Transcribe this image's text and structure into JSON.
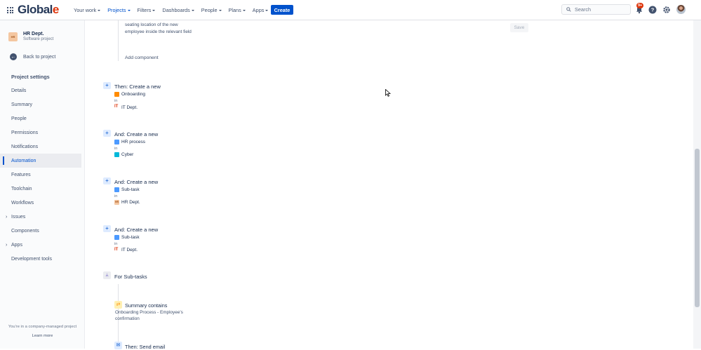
{
  "topnav": {
    "logo_main": "Global",
    "logo_accent": "e",
    "items": [
      {
        "label": "Your work"
      },
      {
        "label": "Projects"
      },
      {
        "label": "Filters"
      },
      {
        "label": "Dashboards"
      },
      {
        "label": "People"
      },
      {
        "label": "Plans"
      },
      {
        "label": "Apps"
      }
    ],
    "create_label": "Create",
    "search_placeholder": "Search",
    "notif_badge": "9+"
  },
  "sidebar": {
    "project_name": "HR Dept.",
    "project_type": "Software project",
    "project_avatar": "HR",
    "back_label": "Back to project",
    "section_title": "Project settings",
    "items": [
      {
        "label": "Details"
      },
      {
        "label": "Summary"
      },
      {
        "label": "People"
      },
      {
        "label": "Permissions"
      },
      {
        "label": "Notifications"
      },
      {
        "label": "Automation"
      },
      {
        "label": "Features"
      },
      {
        "label": "Toolchain"
      },
      {
        "label": "Workflows"
      },
      {
        "label": "Issues"
      },
      {
        "label": "Components"
      },
      {
        "label": "Apps"
      },
      {
        "label": "Development tools"
      }
    ],
    "footer_text": "You're in a company-managed project",
    "footer_link": "Learn more"
  },
  "main": {
    "text_line1": "seating location of the new",
    "text_line2": "employee inside the relevant field",
    "save_label": "Save",
    "add_component": "Add component",
    "in_label": "in",
    "actions": [
      {
        "title": "Then: Create a new",
        "issue_type": "Onboarding",
        "project": "IT Dept."
      },
      {
        "title": "And: Create a new",
        "issue_type": "HR process",
        "project": "Cyber"
      },
      {
        "title": "And: Create a new",
        "issue_type": "Sub-task",
        "project": "HR Dept."
      },
      {
        "title": "And: Create a new",
        "issue_type": "Sub-task",
        "project": "IT Dept."
      }
    ],
    "branch_label": "For Sub-tasks",
    "condition_title": "Summary contains",
    "condition_line1": "Onboarding Process - Employee's",
    "condition_line2": "confirmation",
    "email_label": "Then: Send email"
  },
  "colors": {
    "accent": "#0052cc",
    "logo_accent": "#de350b",
    "sidebar_bg": "#fafbfc"
  }
}
